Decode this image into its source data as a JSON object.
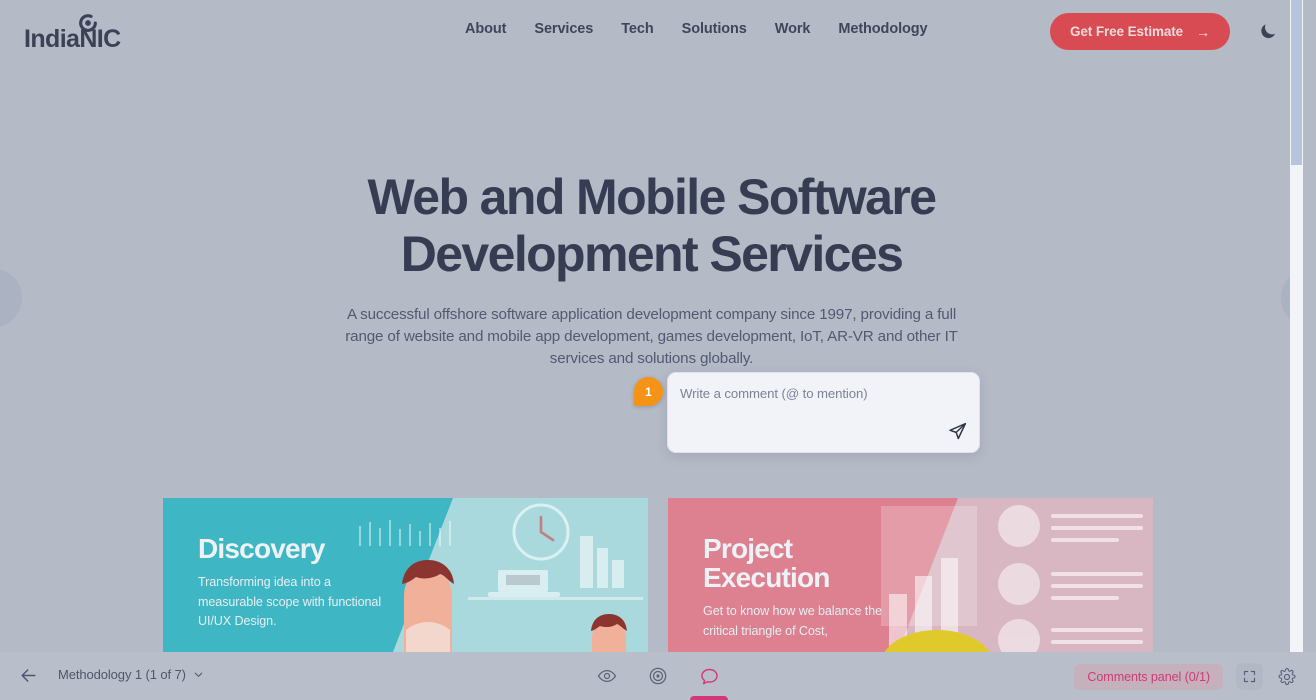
{
  "site": {
    "logo": {
      "text": "IndiaNIC",
      "mark": "circle-dot-logo-icon"
    },
    "nav": [
      {
        "label": "About"
      },
      {
        "label": "Services"
      },
      {
        "label": "Tech"
      },
      {
        "label": "Solutions"
      },
      {
        "label": "Work"
      },
      {
        "label": "Methodology"
      }
    ],
    "cta": {
      "label": "Get Free Estimate",
      "arrow": "→",
      "color": "#d94b53"
    },
    "theme_toggle": "moon-icon",
    "hero": {
      "title_line1": "Web and Mobile Software",
      "title_line2": "Development Services",
      "subtitle": "A successful offshore software application development company since 1997, providing a full range of website and mobile app development, games development, IoT, AR-VR and other IT services and solutions globally."
    },
    "cards": [
      {
        "title": "Discovery",
        "desc": "Transforming idea into a measurable scope with functional UI/UX Design.",
        "color": "#3fb6c4",
        "bg": "#a9d9dd"
      },
      {
        "title": "Project Execution",
        "desc": "Get to know how we balance the critical triangle of Cost,",
        "color": "#dd8090",
        "bg": "#d8b6c2"
      }
    ],
    "edge_nav": {
      "prev": "prev-slide-button",
      "next": "next-slide-button"
    }
  },
  "annotation": {
    "pin": {
      "number": "1",
      "color": "#f59316"
    },
    "composer": {
      "placeholder": "Write a comment (@ to mention)",
      "value": "",
      "send_icon": "send-paper-plane-icon"
    }
  },
  "toolbar": {
    "back_icon": "arrow-left-icon",
    "page_title": "Methodology 1  (1 of 7)",
    "chevron": "chevron-down-icon",
    "tools": [
      {
        "name": "preview-eye-icon",
        "active": false
      },
      {
        "name": "target-focus-icon",
        "active": false
      },
      {
        "name": "comment-bubble-icon",
        "active": true
      }
    ],
    "comments_panel": {
      "label": "Comments panel (0/1)",
      "color": "#cf3a79"
    },
    "fullscreen_icon": "fullscreen-icon",
    "settings_icon": "gear-icon"
  }
}
